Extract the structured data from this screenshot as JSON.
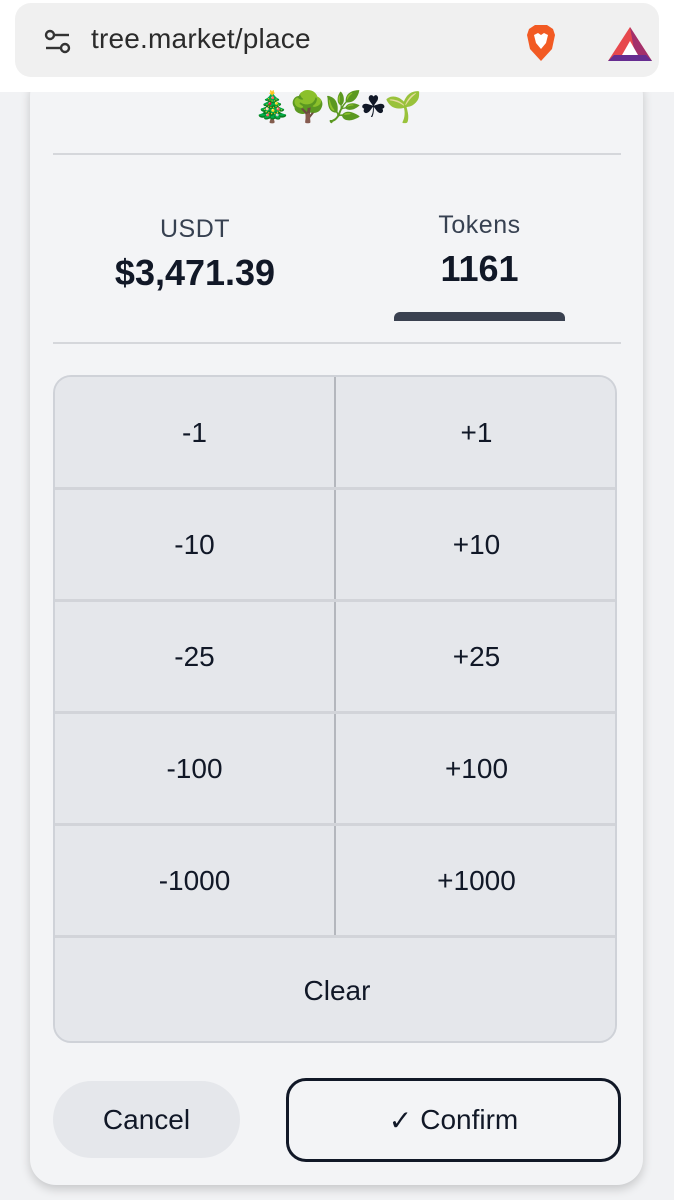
{
  "browser": {
    "url": "tree.market/place",
    "icons": [
      "tune-icon",
      "brave-lion-icon",
      "bat-triangle-icon"
    ]
  },
  "header": {
    "emojis": "🎄🌳🌿☘🌱"
  },
  "stats": {
    "usdt": {
      "label": "USDT",
      "value": "$3,471.39"
    },
    "tokens": {
      "label": "Tokens",
      "value": "1161",
      "selected": true
    }
  },
  "keypad": {
    "rows": [
      {
        "minus": "-1",
        "plus": "+1"
      },
      {
        "minus": "-10",
        "plus": "+10"
      },
      {
        "minus": "-25",
        "plus": "+25"
      },
      {
        "minus": "-100",
        "plus": "+100"
      },
      {
        "minus": "-1000",
        "plus": "+1000"
      }
    ],
    "clear_label": "Clear"
  },
  "actions": {
    "cancel_label": "Cancel",
    "confirm_check": "✓",
    "confirm_label": "Confirm"
  },
  "colors": {
    "text": "#111827",
    "keypad_bg": "#e5e7eb",
    "indicator": "#3a4150"
  }
}
